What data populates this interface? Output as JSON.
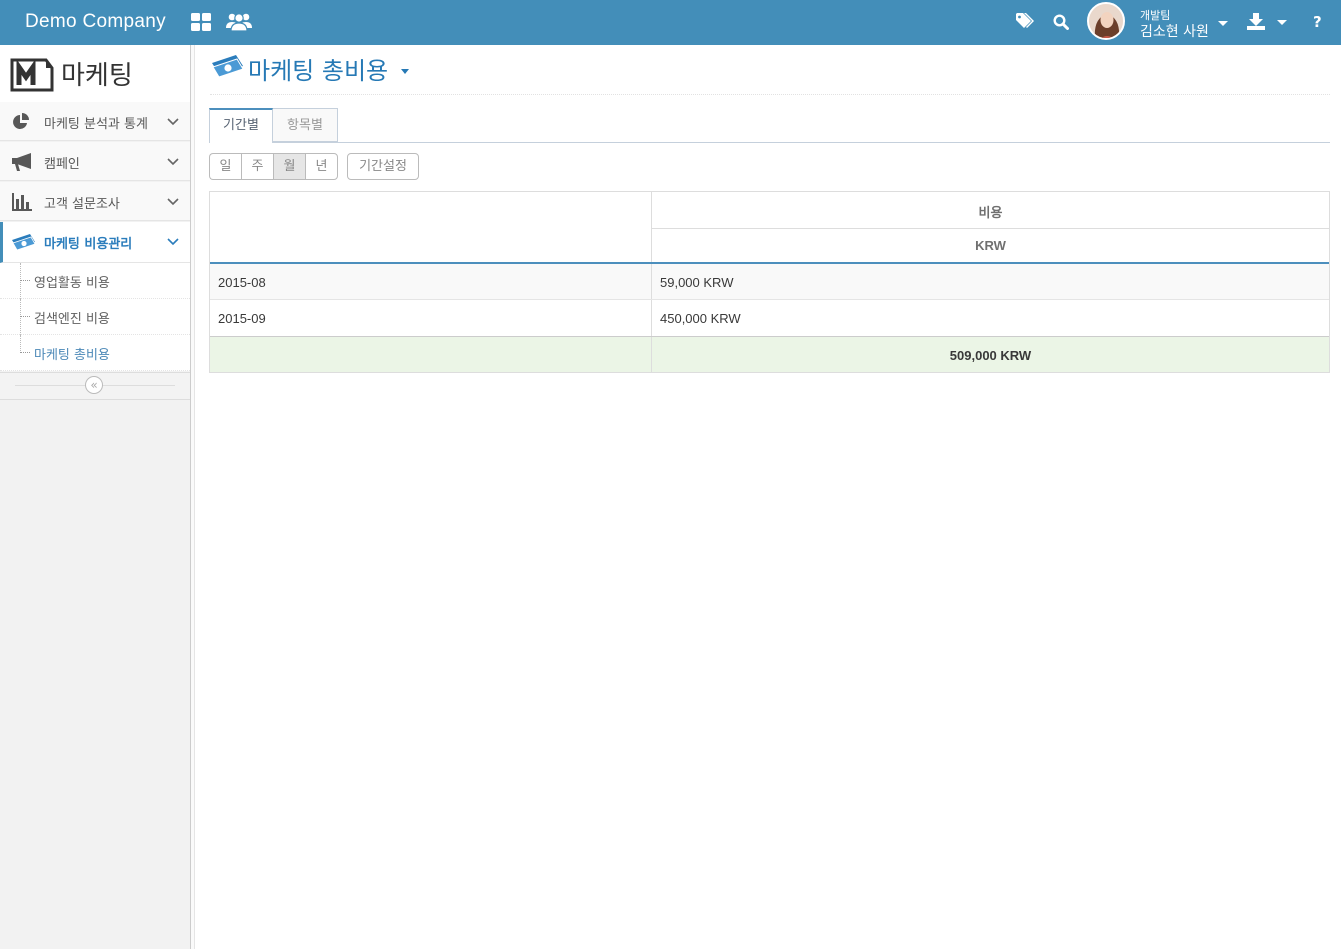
{
  "navbar": {
    "brand": "Demo Company",
    "user": {
      "team": "개발팀",
      "name": "김소현 사원"
    },
    "icons": [
      "grid-icon",
      "users-icon",
      "tags-icon",
      "search-icon",
      "download-icon",
      "help-icon"
    ],
    "help_label": "?"
  },
  "sidebar": {
    "title": "마케팅",
    "logo_letter": "M",
    "items": [
      {
        "label": "마케팅 분석과 통계",
        "icon": "pie-chart-icon"
      },
      {
        "label": "캠페인",
        "icon": "bullhorn-icon"
      },
      {
        "label": "고객 설문조사",
        "icon": "bar-chart-icon"
      },
      {
        "label": "마케팅 비용관리",
        "icon": "money-icon",
        "active": true
      }
    ],
    "subitems": [
      {
        "label": "영업활동 비용"
      },
      {
        "label": "검색엔진 비용"
      },
      {
        "label": "마케팅 총비용",
        "current": true
      }
    ],
    "collapse_label": "«"
  },
  "page": {
    "title": "마케팅 총비용",
    "tabs": [
      {
        "label": "기간별",
        "active": true
      },
      {
        "label": "항목별"
      }
    ],
    "period_buttons": [
      {
        "label": "일"
      },
      {
        "label": "주"
      },
      {
        "label": "월",
        "selected": true
      },
      {
        "label": "년"
      }
    ],
    "period_setting_label": "기간설정"
  },
  "table": {
    "header_group": "비용",
    "header_currency": "KRW",
    "rows": [
      {
        "period": "2015-08",
        "amount": "59,000 KRW"
      },
      {
        "period": "2015-09",
        "amount": "450,000 KRW"
      }
    ],
    "total": "509,000 KRW"
  },
  "colors": {
    "navbar": "#438eb9",
    "accent": "#2679b5",
    "total_row": "#ebf5e6"
  }
}
